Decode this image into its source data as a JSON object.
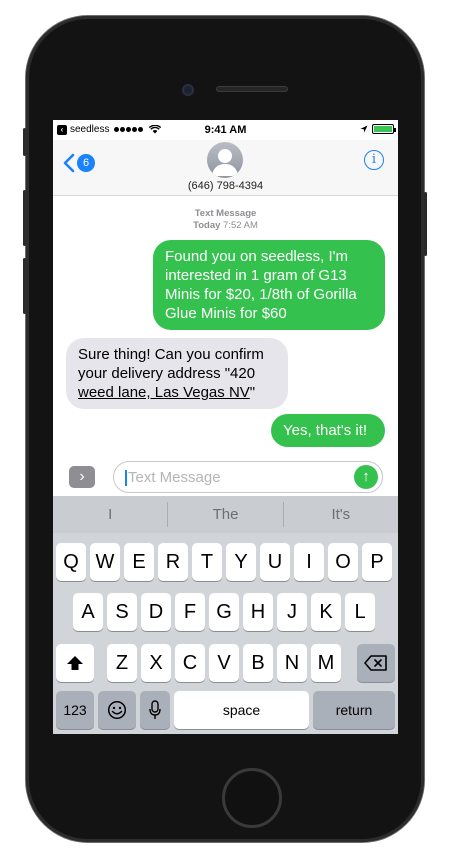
{
  "status_bar": {
    "carrier": "seedless",
    "time": "9:41 AM"
  },
  "nav": {
    "back_badge": "6",
    "contact_phone": "(646) 798-4394"
  },
  "thread": {
    "meta_label": "Text Message",
    "meta_day": "Today",
    "meta_time": "7:52 AM",
    "messages": [
      {
        "direction": "outgoing",
        "text": "Found you on seedless, I'm interested in 1 gram of G13 Minis for $20, 1/8th of Gorilla Glue Minis for $60"
      },
      {
        "direction": "incoming",
        "text_prefix": "Sure thing! Can you confirm your delivery address \"420 ",
        "text_link": "weed lane, Las Vegas NV",
        "text_suffix": "\""
      },
      {
        "direction": "outgoing",
        "text": "Yes, that's it!"
      }
    ]
  },
  "composer": {
    "placeholder": "Text Message",
    "apps_icon": "chevron-right-icon",
    "send_icon": "arrow-up-icon"
  },
  "keyboard": {
    "suggestions": [
      "I",
      "The",
      "It's"
    ],
    "row1": [
      "Q",
      "W",
      "E",
      "R",
      "T",
      "Y",
      "U",
      "I",
      "O",
      "P"
    ],
    "row2": [
      "A",
      "S",
      "D",
      "F",
      "G",
      "H",
      "J",
      "K",
      "L"
    ],
    "row3": [
      "Z",
      "X",
      "C",
      "V",
      "B",
      "N",
      "M"
    ],
    "numbers_label": "123",
    "space_label": "space",
    "return_label": "return"
  },
  "colors": {
    "outgoing_bubble": "#35c14e",
    "incoming_bubble": "#e6e5eb",
    "accent_blue": "#1a82fb"
  }
}
